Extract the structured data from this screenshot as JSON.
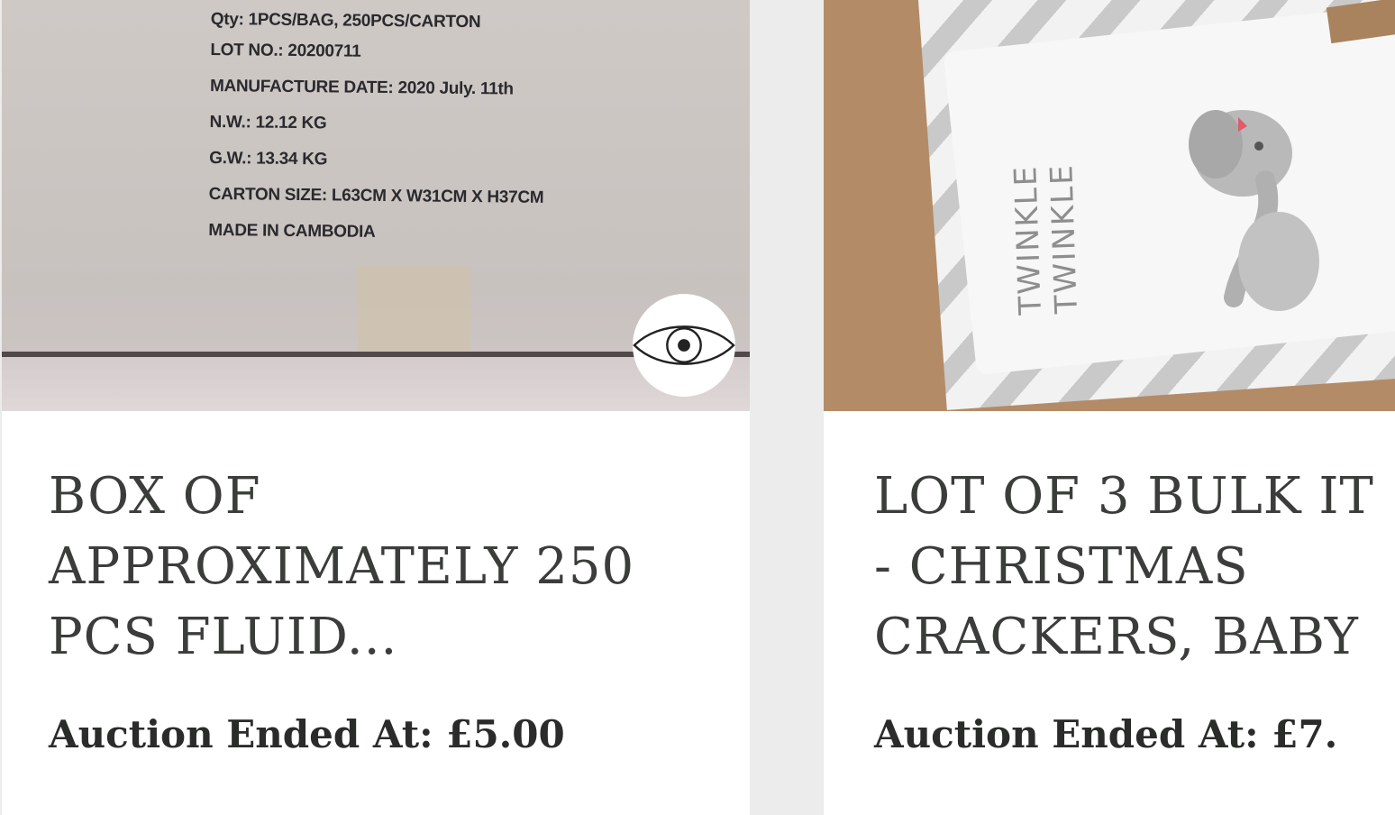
{
  "cards": [
    {
      "image_label_lines": [
        "Qty: 1PCS/BAG, 250PCS/CARTON",
        "LOT NO.: 20200711",
        "MANUFACTURE DATE: 2020 July. 11th",
        "N.W.: 12.12 KG",
        "G.W.: 13.34 KG",
        "CARTON SIZE: L63CM X W31CM X H37CM",
        "MADE IN CAMBODIA"
      ],
      "view_icon": "eye-icon",
      "title_lines": [
        "BOX OF",
        "APPROXIMATELY 250",
        "PCS FLUID..."
      ],
      "price_text": "Auction Ended At: £5.00"
    },
    {
      "image_text_lines": [
        "TWINKLE",
        "TWINKLE"
      ],
      "title_lines": [
        "LOT OF 3 BULK IT",
        "- CHRISTMAS",
        "CRACKERS, BABY"
      ],
      "price_text": "Auction Ended At: £7."
    }
  ],
  "colors": {
    "page_background": "#ececec",
    "card_background": "#ffffff",
    "title_text": "#3a3d3a",
    "price_text": "#2a2c2a"
  }
}
